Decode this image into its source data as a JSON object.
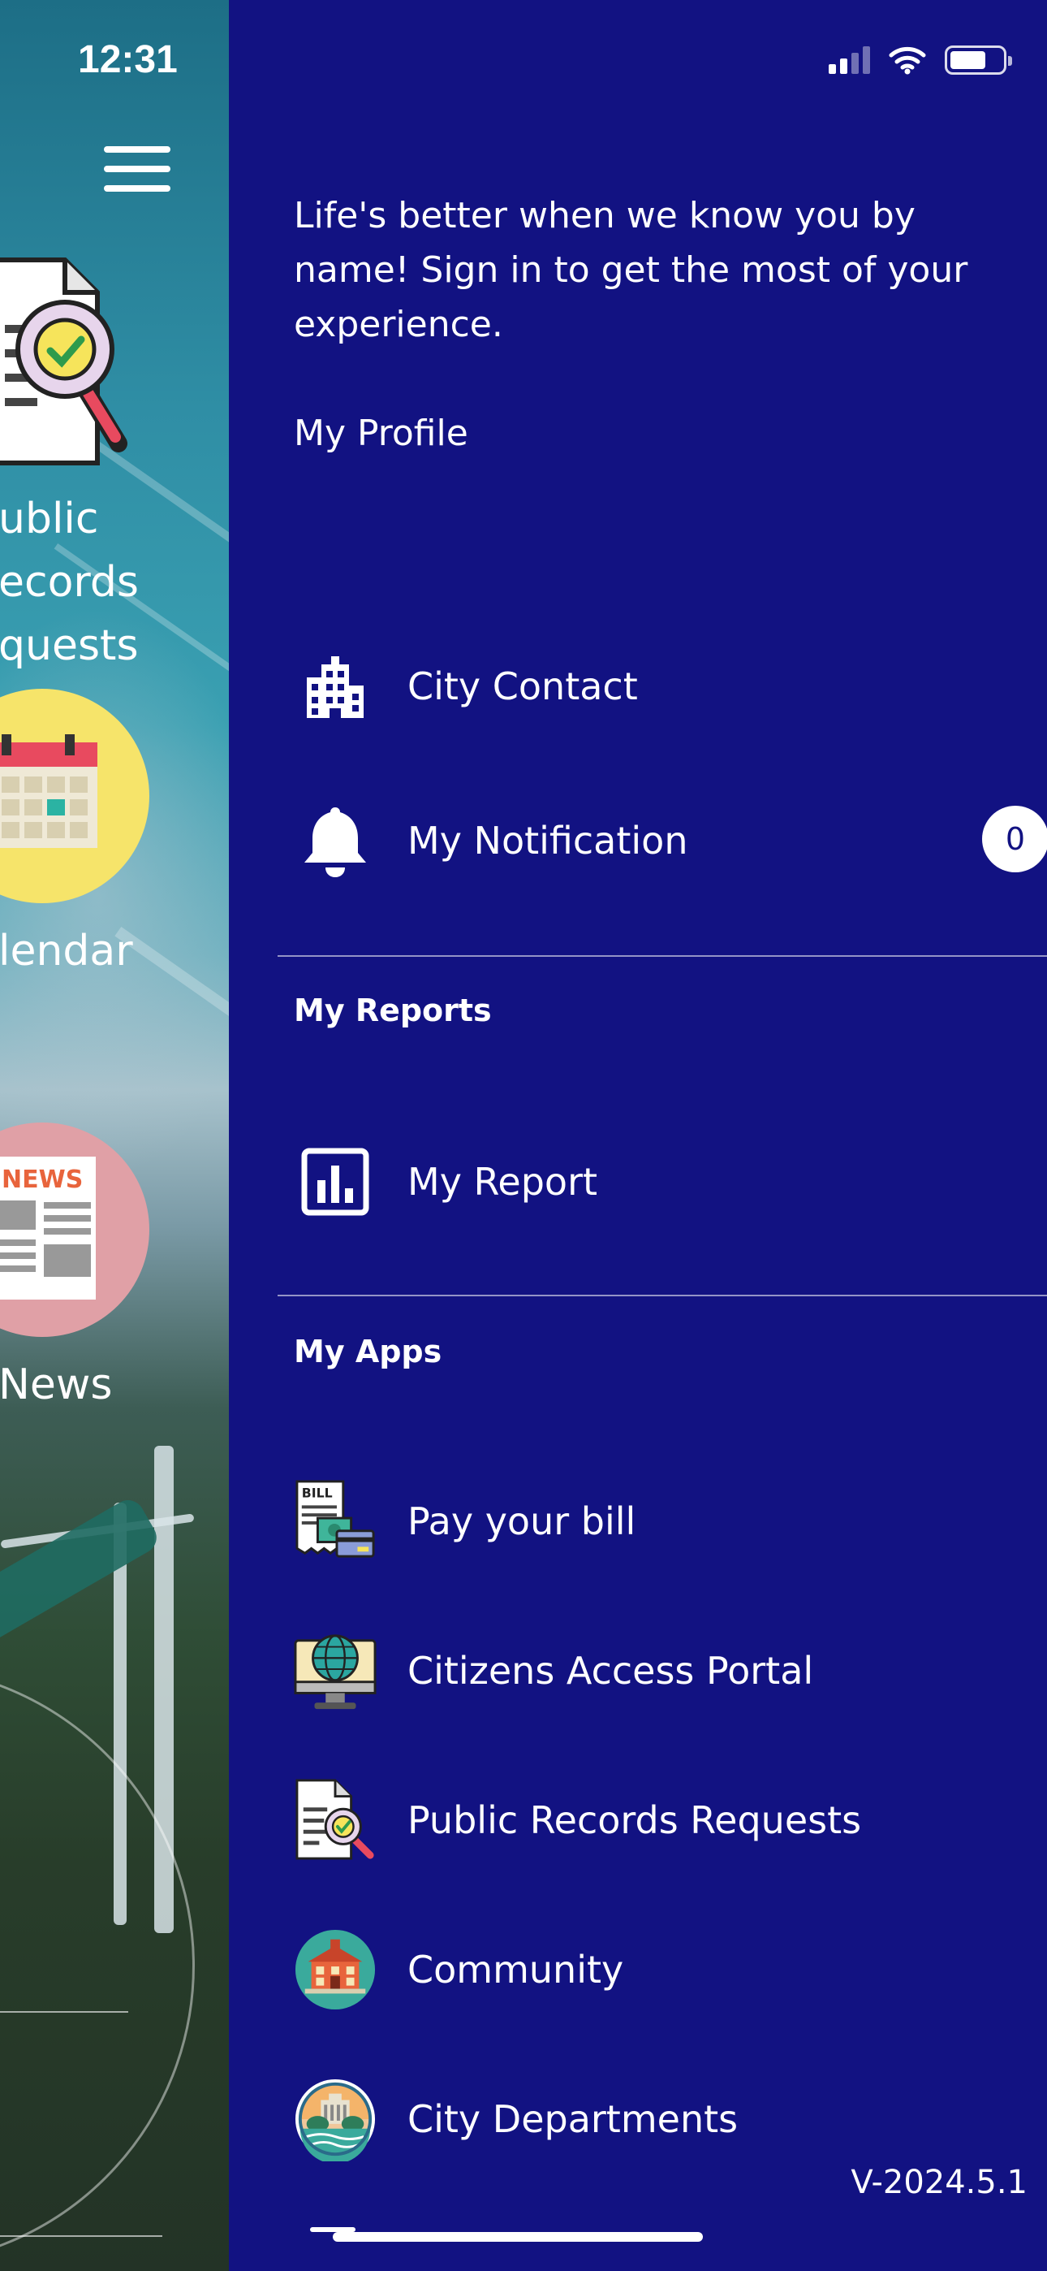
{
  "status_bar": {
    "time": "12:31"
  },
  "background_tiles": [
    {
      "icon": "document-magnifier-icon",
      "label": "Public\nRecords\nRequests",
      "label_visible": "ublic\necords\nquests"
    },
    {
      "icon": "calendar-icon",
      "label_visible": "lendar"
    },
    {
      "icon": "news-icon",
      "label_visible": "News"
    }
  ],
  "drawer": {
    "intro_text": "Life's better when we know you by name! Sign in to get the most of your experience.",
    "profile_link": "My Profile",
    "items": [
      {
        "icon": "building-icon",
        "label": "City Contact"
      },
      {
        "icon": "bell-icon",
        "label": "My Notification",
        "badge": "0"
      }
    ],
    "sections": [
      {
        "title": "My Reports",
        "items": [
          {
            "icon": "bar-chart-icon",
            "label": "My Report"
          }
        ]
      },
      {
        "title": "My Apps",
        "items": [
          {
            "icon": "bill-icon",
            "label": "Pay your bill"
          },
          {
            "icon": "globe-computer-icon",
            "label": "Citizens Access Portal"
          },
          {
            "icon": "document-magnifier-icon",
            "label": "Public Records Requests"
          },
          {
            "icon": "community-building-icon",
            "label": "Community"
          },
          {
            "icon": "city-seal-icon",
            "label": "City Departments"
          }
        ]
      }
    ],
    "version": "V-2024.5.1"
  },
  "colors": {
    "drawer_bg": "#121282",
    "text": "#ffffff",
    "calendar_circle": "#f6e46a",
    "news_circle": "#e0a0a6"
  }
}
